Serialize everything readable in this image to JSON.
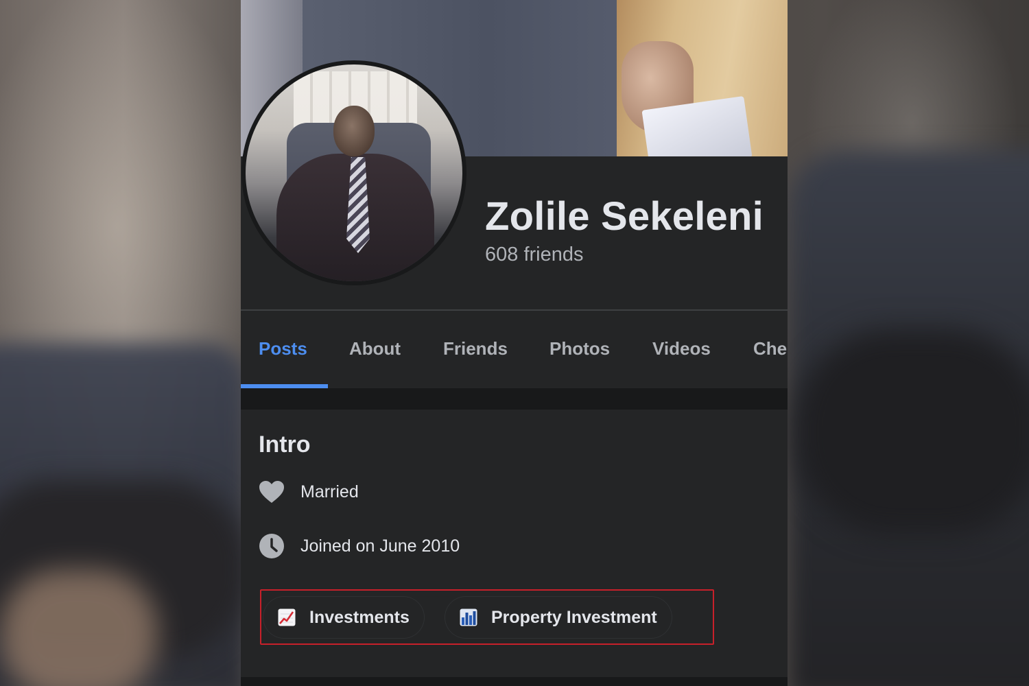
{
  "profile": {
    "name": "Zolile Sekeleni",
    "friends": "608 friends"
  },
  "tabs": [
    {
      "label": "Posts",
      "active": true
    },
    {
      "label": "About"
    },
    {
      "label": "Friends"
    },
    {
      "label": "Photos"
    },
    {
      "label": "Videos"
    },
    {
      "label": "Che"
    }
  ],
  "intro": {
    "title": "Intro",
    "items": [
      {
        "icon": "heart-icon",
        "text": "Married"
      },
      {
        "icon": "clock-icon",
        "text": "Joined on June 2010"
      }
    ],
    "tags": [
      {
        "icon": "chart-increasing-icon",
        "label": "Investments"
      },
      {
        "icon": "bar-chart-icon",
        "label": "Property Investment"
      }
    ]
  },
  "colors": {
    "accent": "#4d8ef0",
    "card_bg": "#242526",
    "highlight_border": "#c8202a"
  }
}
